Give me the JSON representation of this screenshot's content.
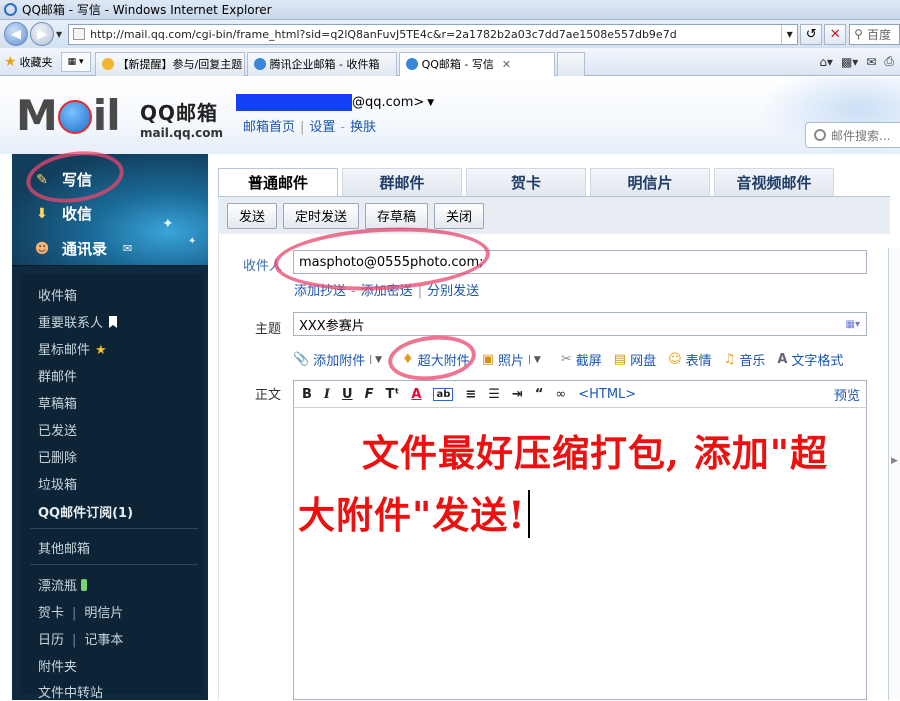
{
  "window": {
    "title": "QQ邮箱 - 写信 - Windows Internet Explorer"
  },
  "address": {
    "url": "http://mail.qq.com/cgi-bin/frame_html?sid=q2lQ8anFuvJ5TE4c&r=2a1782b2a03c7dd7ae1508e557db9e7d",
    "search_placeholder": "百度"
  },
  "favorites": {
    "label": "收藏夹"
  },
  "browser_tabs": [
    {
      "label": "【新提醒】参与/回复主题 ..."
    },
    {
      "label": "腾讯企业邮箱 - 收件箱"
    },
    {
      "label": "QQ邮箱 - 写信"
    }
  ],
  "header": {
    "logo_left": "M",
    "logo_right": "il",
    "brand_cn": "QQ邮箱",
    "brand_en": "mail.qq.com",
    "account_suffix": "@qq.com>",
    "links": [
      "邮箱首页",
      "设置",
      "换肤"
    ],
    "search_placeholder": "邮件搜索..."
  },
  "sidebar": {
    "main": [
      {
        "label": "写信"
      },
      {
        "label": "收信"
      },
      {
        "label": "通讯录"
      }
    ],
    "folders": {
      "inbox": "收件箱",
      "vip": "重要联系人",
      "starred": "星标邮件",
      "group": "群邮件",
      "drafts": "草稿箱",
      "sent": "已发送",
      "deleted": "已删除",
      "spam": "垃圾箱",
      "subscriptions": "QQ邮件订阅(1)",
      "other": "其他邮箱",
      "bottle": "漂流瓶",
      "greeting": "贺卡",
      "postcard": "明信片",
      "calendar": "日历",
      "notes": "记事本",
      "attachments": "附件夹",
      "transfer": "文件中转站"
    }
  },
  "compose": {
    "tabs": [
      "普通邮件",
      "群邮件",
      "贺卡",
      "明信片",
      "音视频邮件"
    ],
    "toolbar": [
      "发送",
      "定时发送",
      "存草稿",
      "关闭"
    ],
    "to_label": "收件人",
    "to_value": "masphoto@0555photo.com;",
    "to_links": [
      "添加抄送",
      "添加密送",
      "分别发送"
    ],
    "subject_label": "主题",
    "subject_value": "XXX参赛片",
    "attach": {
      "add": "添加附件",
      "big": "超大附件",
      "photo": "照片",
      "screenshot": "截屏",
      "disk": "网盘",
      "emoji": "表情",
      "music": "音乐",
      "format": "文字格式"
    },
    "body_label": "正文",
    "editor": {
      "html": "<HTML>",
      "preview": "预览"
    },
    "body_text": "文件最好压缩打包, 添加\"超大附件\"发送!"
  },
  "colors": {
    "annotation": "#e8466e",
    "body_text": "#ee0f0f",
    "sidebar": "#0f2a3f"
  }
}
